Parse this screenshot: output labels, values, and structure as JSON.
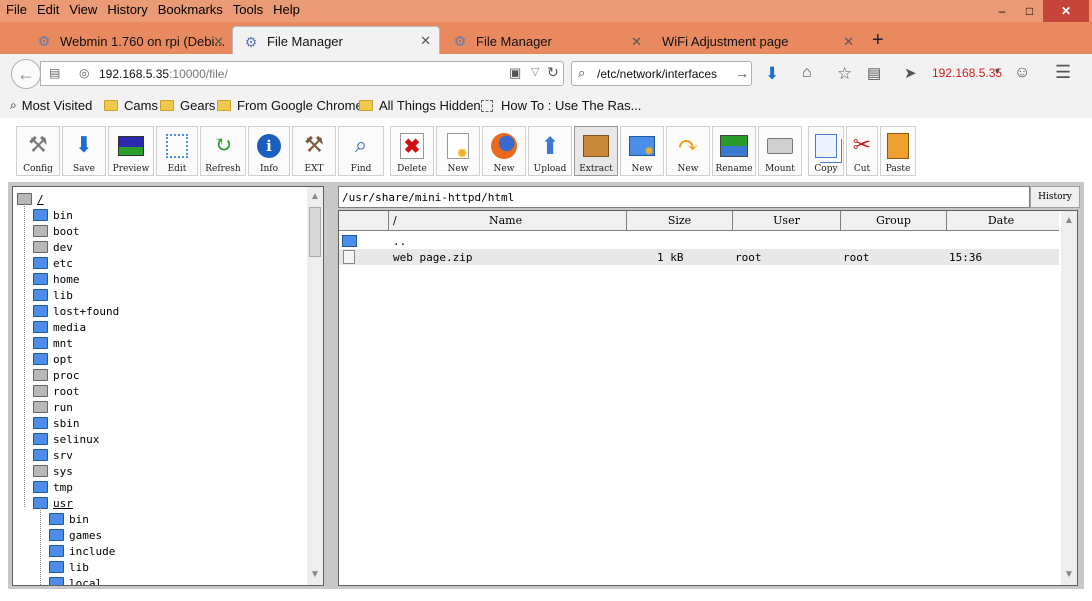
{
  "menu": [
    "File",
    "Edit",
    "View",
    "History",
    "Bookmarks",
    "Tools",
    "Help"
  ],
  "tabs": [
    {
      "label": "Webmin 1.760 on rpi (Debi..."
    },
    {
      "label": "File Manager"
    },
    {
      "label": "File Manager"
    },
    {
      "label": "WiFi Adjustment page"
    }
  ],
  "address": {
    "host": "192.168.5.35",
    "rest": ":10000/file/"
  },
  "search": {
    "value": "/etc/network/interfaces"
  },
  "ip_label": "192.168.5.35",
  "bookmarks": [
    "Most Visited",
    "Cams",
    "Gears",
    "From Google Chrome",
    "All Things Hidden",
    "How To : Use The Ras..."
  ],
  "toolbar": [
    "Config",
    "Save",
    "Preview",
    "Edit",
    "Refresh",
    "Info",
    "EXT",
    "Find",
    "Delete",
    "New",
    "New",
    "Upload",
    "Extract",
    "New",
    "New",
    "Rename",
    "Mount",
    "Copy",
    "Cut",
    "Paste"
  ],
  "tree": {
    "root": "/",
    "items": [
      {
        "name": "bin",
        "color": "blue"
      },
      {
        "name": "boot",
        "color": "gray"
      },
      {
        "name": "dev",
        "color": "gray"
      },
      {
        "name": "etc",
        "color": "blue"
      },
      {
        "name": "home",
        "color": "blue"
      },
      {
        "name": "lib",
        "color": "blue"
      },
      {
        "name": "lost+found",
        "color": "blue"
      },
      {
        "name": "media",
        "color": "blue"
      },
      {
        "name": "mnt",
        "color": "blue"
      },
      {
        "name": "opt",
        "color": "blue"
      },
      {
        "name": "proc",
        "color": "gray"
      },
      {
        "name": "root",
        "color": "gray"
      },
      {
        "name": "run",
        "color": "gray"
      },
      {
        "name": "sbin",
        "color": "blue"
      },
      {
        "name": "selinux",
        "color": "blue"
      },
      {
        "name": "srv",
        "color": "blue"
      },
      {
        "name": "sys",
        "color": "gray"
      },
      {
        "name": "tmp",
        "color": "blue"
      },
      {
        "name": "usr",
        "color": "blue"
      }
    ],
    "usr_children": [
      "bin",
      "games",
      "include",
      "lib",
      "local"
    ]
  },
  "path": "/usr/share/mini-httpd/html",
  "history_label": "History",
  "list": {
    "headers": [
      "/",
      "Name",
      "Size",
      "User",
      "Group",
      "Date"
    ],
    "rows": [
      {
        "name": "..",
        "size": "",
        "user": "",
        "group": "",
        "date": "",
        "type": "folder"
      },
      {
        "name": "web page.zip",
        "size": "1 kB",
        "user": "root",
        "group": "root",
        "date": "15:36",
        "type": "file"
      }
    ]
  }
}
